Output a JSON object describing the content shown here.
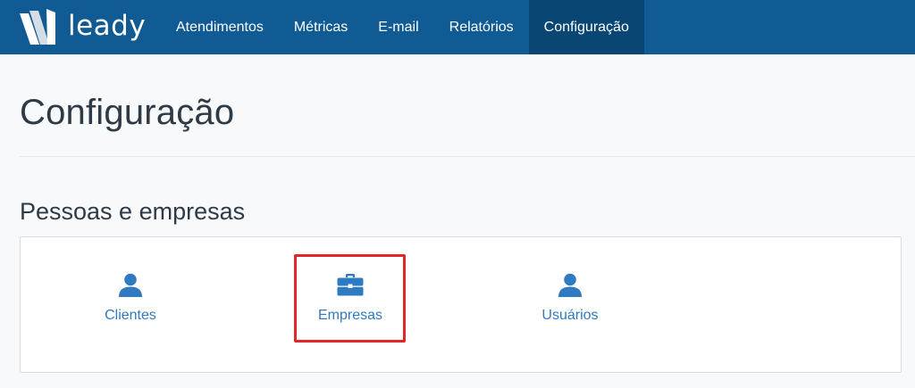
{
  "brand": {
    "name": "leady",
    "icon": "leady-logo-icon"
  },
  "nav": {
    "items": [
      {
        "label": "Atendimentos",
        "active": false
      },
      {
        "label": "Métricas",
        "active": false
      },
      {
        "label": "E-mail",
        "active": false
      },
      {
        "label": "Relatórios",
        "active": false
      },
      {
        "label": "Configuração",
        "active": true
      }
    ]
  },
  "page": {
    "title": "Configuração"
  },
  "section": {
    "title": "Pessoas e empresas",
    "items": [
      {
        "label": "Clientes",
        "icon": "user-icon"
      },
      {
        "label": "Empresas",
        "icon": "briefcase-icon"
      },
      {
        "label": "Usuários",
        "icon": "user-icon"
      }
    ]
  },
  "colors": {
    "navbar": "#105b94",
    "nav_active": "#0a4674",
    "link": "#2f7ac0",
    "highlight": "#e0262b"
  }
}
